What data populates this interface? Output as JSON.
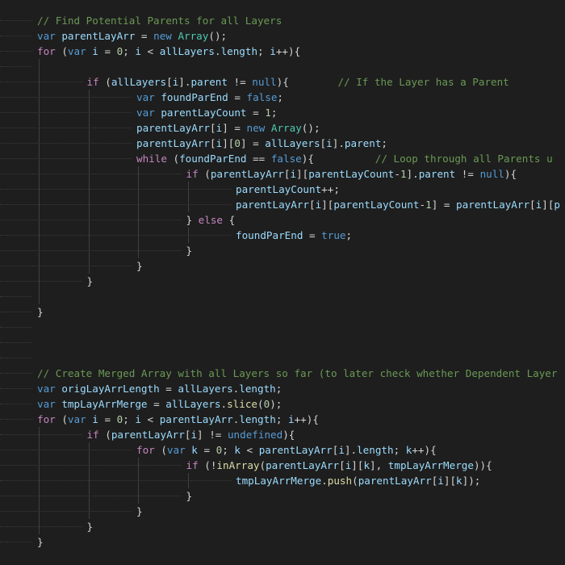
{
  "editor": {
    "theme_colors": {
      "background": "#1e1e1e",
      "comment": "#6a9955",
      "keyword": "#569cd6",
      "control_keyword": "#c586c0",
      "variable": "#9cdcfe",
      "punctuation": "#d4d4d4",
      "number": "#b5cea8",
      "type": "#4ec9b0",
      "function": "#dcdcaa"
    },
    "lines": [
      {
        "indent": 0,
        "tokens": [
          [
            "c",
            "// Find Potential Parents for all Layers"
          ]
        ]
      },
      {
        "indent": 0,
        "tokens": [
          [
            "k",
            "var"
          ],
          [
            "p",
            " "
          ],
          [
            "v",
            "parentLayArr"
          ],
          [
            "p",
            " = "
          ],
          [
            "k",
            "new"
          ],
          [
            "p",
            " "
          ],
          [
            "t",
            "Array"
          ],
          [
            "p",
            "();"
          ]
        ]
      },
      {
        "indent": 0,
        "tokens": [
          [
            "kc",
            "for"
          ],
          [
            "p",
            " ("
          ],
          [
            "k",
            "var"
          ],
          [
            "p",
            " "
          ],
          [
            "v",
            "i"
          ],
          [
            "p",
            " = "
          ],
          [
            "n",
            "0"
          ],
          [
            "p",
            "; "
          ],
          [
            "v",
            "i"
          ],
          [
            "p",
            " < "
          ],
          [
            "v",
            "allLayers"
          ],
          [
            "p",
            "."
          ],
          [
            "v",
            "length"
          ],
          [
            "p",
            "; "
          ],
          [
            "v",
            "i"
          ],
          [
            "p",
            "++){"
          ]
        ]
      },
      {
        "indent": 0,
        "tokens": []
      },
      {
        "indent": 1,
        "tokens": [
          [
            "kc",
            "if"
          ],
          [
            "p",
            " ("
          ],
          [
            "v",
            "allLayers"
          ],
          [
            "p",
            "["
          ],
          [
            "v",
            "i"
          ],
          [
            "p",
            "]."
          ],
          [
            "v",
            "parent"
          ],
          [
            "p",
            " != "
          ],
          [
            "k",
            "null"
          ],
          [
            "p",
            "){        "
          ],
          [
            "c",
            "// If the Layer has a Parent"
          ]
        ]
      },
      {
        "indent": 2,
        "tokens": [
          [
            "k",
            "var"
          ],
          [
            "p",
            " "
          ],
          [
            "v",
            "foundParEnd"
          ],
          [
            "p",
            " = "
          ],
          [
            "k",
            "false"
          ],
          [
            "p",
            ";"
          ]
        ]
      },
      {
        "indent": 2,
        "tokens": [
          [
            "k",
            "var"
          ],
          [
            "p",
            " "
          ],
          [
            "v",
            "parentLayCount"
          ],
          [
            "p",
            " = "
          ],
          [
            "n",
            "1"
          ],
          [
            "p",
            ";"
          ]
        ]
      },
      {
        "indent": 2,
        "tokens": [
          [
            "v",
            "parentLayArr"
          ],
          [
            "p",
            "["
          ],
          [
            "v",
            "i"
          ],
          [
            "p",
            "] = "
          ],
          [
            "k",
            "new"
          ],
          [
            "p",
            " "
          ],
          [
            "t",
            "Array"
          ],
          [
            "p",
            "();"
          ]
        ]
      },
      {
        "indent": 2,
        "tokens": [
          [
            "v",
            "parentLayArr"
          ],
          [
            "p",
            "["
          ],
          [
            "v",
            "i"
          ],
          [
            "p",
            "]["
          ],
          [
            "n",
            "0"
          ],
          [
            "p",
            "] = "
          ],
          [
            "v",
            "allLayers"
          ],
          [
            "p",
            "["
          ],
          [
            "v",
            "i"
          ],
          [
            "p",
            "]."
          ],
          [
            "v",
            "parent"
          ],
          [
            "p",
            ";"
          ]
        ]
      },
      {
        "indent": 2,
        "tokens": [
          [
            "kc",
            "while"
          ],
          [
            "p",
            " ("
          ],
          [
            "v",
            "foundParEnd"
          ],
          [
            "p",
            " == "
          ],
          [
            "k",
            "false"
          ],
          [
            "p",
            "){          "
          ],
          [
            "c",
            "// Loop through all Parents u"
          ]
        ]
      },
      {
        "indent": 3,
        "tokens": [
          [
            "kc",
            "if"
          ],
          [
            "p",
            " ("
          ],
          [
            "v",
            "parentLayArr"
          ],
          [
            "p",
            "["
          ],
          [
            "v",
            "i"
          ],
          [
            "p",
            "]["
          ],
          [
            "v",
            "parentLayCount"
          ],
          [
            "p",
            "-"
          ],
          [
            "n",
            "1"
          ],
          [
            "p",
            "]."
          ],
          [
            "v",
            "parent"
          ],
          [
            "p",
            " != "
          ],
          [
            "k",
            "null"
          ],
          [
            "p",
            "){"
          ]
        ]
      },
      {
        "indent": 4,
        "tokens": [
          [
            "v",
            "parentLayCount"
          ],
          [
            "p",
            "++;"
          ]
        ]
      },
      {
        "indent": 4,
        "tokens": [
          [
            "v",
            "parentLayArr"
          ],
          [
            "p",
            "["
          ],
          [
            "v",
            "i"
          ],
          [
            "p",
            "]["
          ],
          [
            "v",
            "parentLayCount"
          ],
          [
            "p",
            "-"
          ],
          [
            "n",
            "1"
          ],
          [
            "p",
            "] = "
          ],
          [
            "v",
            "parentLayArr"
          ],
          [
            "p",
            "["
          ],
          [
            "v",
            "i"
          ],
          [
            "p",
            "]["
          ],
          [
            "v",
            "p"
          ]
        ]
      },
      {
        "indent": 3,
        "tokens": [
          [
            "p",
            "} "
          ],
          [
            "kc",
            "else"
          ],
          [
            "p",
            " {"
          ]
        ]
      },
      {
        "indent": 4,
        "tokens": [
          [
            "v",
            "foundParEnd"
          ],
          [
            "p",
            " = "
          ],
          [
            "k",
            "true"
          ],
          [
            "p",
            ";"
          ]
        ]
      },
      {
        "indent": 3,
        "tokens": [
          [
            "p",
            "}"
          ]
        ]
      },
      {
        "indent": 2,
        "tokens": [
          [
            "p",
            "}"
          ]
        ]
      },
      {
        "indent": 1,
        "tokens": [
          [
            "p",
            "}"
          ]
        ]
      },
      {
        "indent": 0,
        "tokens": []
      },
      {
        "indent": 0,
        "tokens": [
          [
            "p",
            "}"
          ]
        ]
      },
      {
        "indent": 0,
        "tokens": []
      },
      {
        "indent": 0,
        "tokens": []
      },
      {
        "indent": 0,
        "tokens": []
      },
      {
        "indent": 0,
        "tokens": [
          [
            "c",
            "// Create Merged Array with all Layers so far (to later check whether Dependent Layer"
          ]
        ]
      },
      {
        "indent": 0,
        "tokens": [
          [
            "k",
            "var"
          ],
          [
            "p",
            " "
          ],
          [
            "v",
            "origLayArrLength"
          ],
          [
            "p",
            " = "
          ],
          [
            "v",
            "allLayers"
          ],
          [
            "p",
            "."
          ],
          [
            "v",
            "length"
          ],
          [
            "p",
            ";"
          ]
        ]
      },
      {
        "indent": 0,
        "tokens": [
          [
            "k",
            "var"
          ],
          [
            "p",
            " "
          ],
          [
            "v",
            "tmpLayArrMerge"
          ],
          [
            "p",
            " = "
          ],
          [
            "v",
            "allLayers"
          ],
          [
            "p",
            "."
          ],
          [
            "f",
            "slice"
          ],
          [
            "p",
            "("
          ],
          [
            "n",
            "0"
          ],
          [
            "p",
            ");"
          ]
        ]
      },
      {
        "indent": 0,
        "tokens": [
          [
            "kc",
            "for"
          ],
          [
            "p",
            " ("
          ],
          [
            "k",
            "var"
          ],
          [
            "p",
            " "
          ],
          [
            "v",
            "i"
          ],
          [
            "p",
            " = "
          ],
          [
            "n",
            "0"
          ],
          [
            "p",
            "; "
          ],
          [
            "v",
            "i"
          ],
          [
            "p",
            " < "
          ],
          [
            "v",
            "parentLayArr"
          ],
          [
            "p",
            "."
          ],
          [
            "v",
            "length"
          ],
          [
            "p",
            "; "
          ],
          [
            "v",
            "i"
          ],
          [
            "p",
            "++){"
          ]
        ]
      },
      {
        "indent": 1,
        "tokens": [
          [
            "kc",
            "if"
          ],
          [
            "p",
            " ("
          ],
          [
            "v",
            "parentLayArr"
          ],
          [
            "p",
            "["
          ],
          [
            "v",
            "i"
          ],
          [
            "p",
            "] != "
          ],
          [
            "k",
            "undefined"
          ],
          [
            "p",
            "){"
          ]
        ]
      },
      {
        "indent": 2,
        "tokens": [
          [
            "kc",
            "for"
          ],
          [
            "p",
            " ("
          ],
          [
            "k",
            "var"
          ],
          [
            "p",
            " "
          ],
          [
            "v",
            "k"
          ],
          [
            "p",
            " = "
          ],
          [
            "n",
            "0"
          ],
          [
            "p",
            "; "
          ],
          [
            "v",
            "k"
          ],
          [
            "p",
            " < "
          ],
          [
            "v",
            "parentLayArr"
          ],
          [
            "p",
            "["
          ],
          [
            "v",
            "i"
          ],
          [
            "p",
            "]."
          ],
          [
            "v",
            "length"
          ],
          [
            "p",
            "; "
          ],
          [
            "v",
            "k"
          ],
          [
            "p",
            "++){"
          ]
        ]
      },
      {
        "indent": 3,
        "tokens": [
          [
            "kc",
            "if"
          ],
          [
            "p",
            " (!"
          ],
          [
            "f",
            "inArray"
          ],
          [
            "p",
            "("
          ],
          [
            "v",
            "parentLayArr"
          ],
          [
            "p",
            "["
          ],
          [
            "v",
            "i"
          ],
          [
            "p",
            "]["
          ],
          [
            "v",
            "k"
          ],
          [
            "p",
            "], "
          ],
          [
            "v",
            "tmpLayArrMerge"
          ],
          [
            "p",
            ")){"
          ]
        ]
      },
      {
        "indent": 4,
        "tokens": [
          [
            "v",
            "tmpLayArrMerge"
          ],
          [
            "p",
            "."
          ],
          [
            "f",
            "push"
          ],
          [
            "p",
            "("
          ],
          [
            "v",
            "parentLayArr"
          ],
          [
            "p",
            "["
          ],
          [
            "v",
            "i"
          ],
          [
            "p",
            "]["
          ],
          [
            "v",
            "k"
          ],
          [
            "p",
            "]);"
          ]
        ]
      },
      {
        "indent": 3,
        "tokens": [
          [
            "p",
            "}"
          ]
        ]
      },
      {
        "indent": 2,
        "tokens": [
          [
            "p",
            "}"
          ]
        ]
      },
      {
        "indent": 1,
        "tokens": [
          [
            "p",
            "}"
          ]
        ]
      },
      {
        "indent": 0,
        "tokens": [
          [
            "p",
            "}"
          ]
        ]
      }
    ]
  }
}
